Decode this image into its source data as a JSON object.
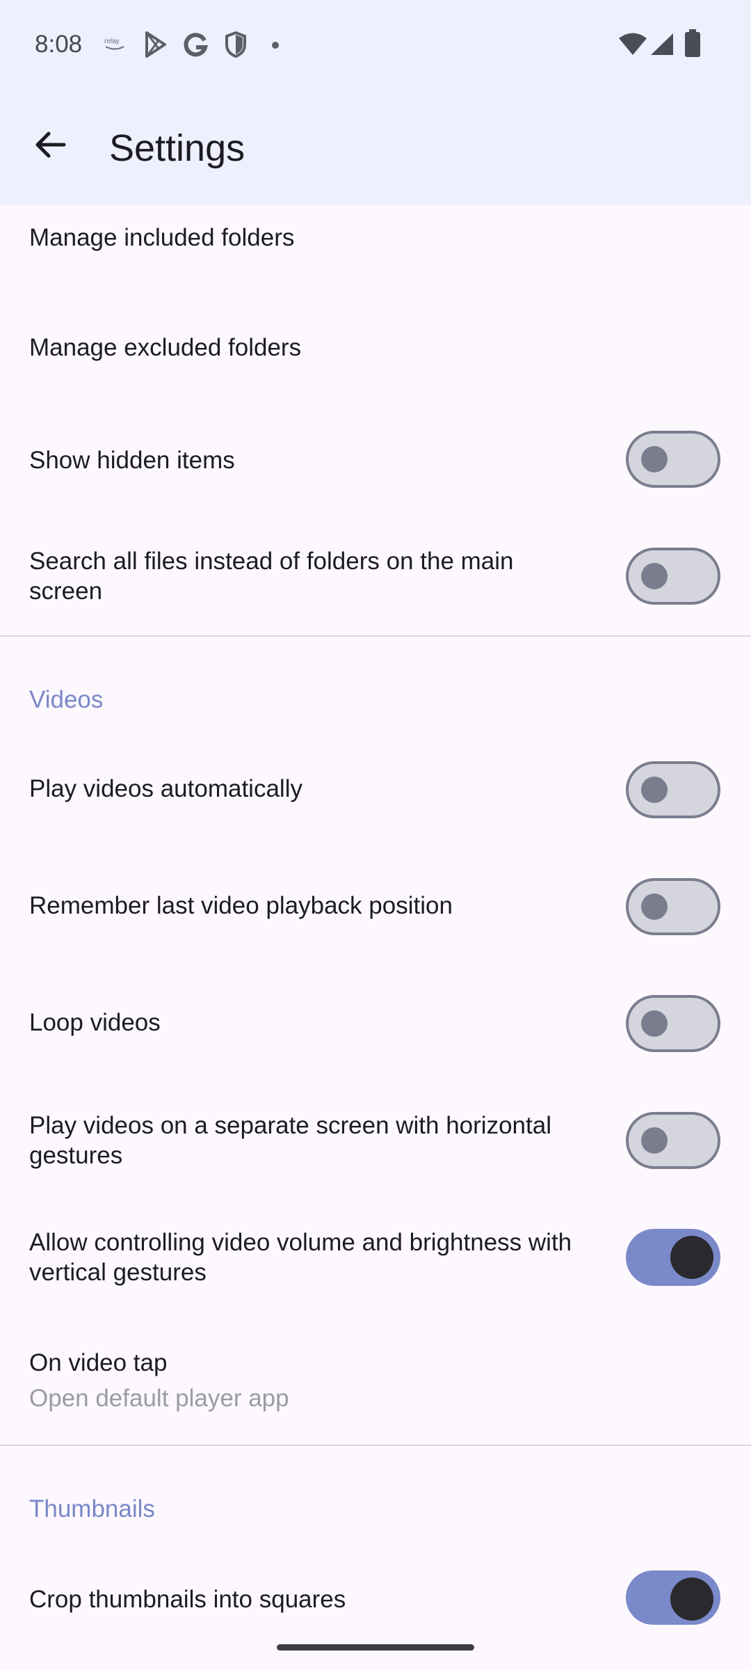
{
  "status_bar": {
    "time": "8:08",
    "left_icons": [
      "relay-icon",
      "play-store-icon",
      "google-icon",
      "shield-icon",
      "dot-icon"
    ],
    "right_icons": [
      "wifi-icon",
      "signal-icon",
      "battery-icon"
    ]
  },
  "app_bar": {
    "title": "Settings",
    "back_icon": "arrow-back-icon"
  },
  "colors": {
    "app_bar_bg": "#eef0fd",
    "page_bg": "#fcf8fd",
    "section_header": "#7a87c8",
    "switch_on": "#7a89c9",
    "switch_off": "#d5d5de"
  },
  "items": {
    "manage_included": "Manage included folders",
    "manage_excluded": "Manage excluded folders",
    "show_hidden": {
      "label": "Show hidden items",
      "checked": false
    },
    "search_all_files": {
      "label": "Search all files instead of folders on the main screen",
      "checked": false
    }
  },
  "videos": {
    "header": "Videos",
    "play_auto": {
      "label": "Play videos automatically",
      "checked": false
    },
    "remember_position": {
      "label": "Remember last video playback position",
      "checked": false
    },
    "loop_videos": {
      "label": "Loop videos",
      "checked": false
    },
    "separate_screen": {
      "label": "Play videos on a separate screen with horizontal gestures",
      "checked": false
    },
    "vertical_gestures": {
      "label": "Allow controlling video volume and brightness with vertical gestures",
      "checked": true
    },
    "on_video_tap": {
      "label": "On video tap",
      "value": "Open default player app"
    }
  },
  "thumbnails": {
    "header": "Thumbnails",
    "crop_squares": {
      "label": "Crop thumbnails into squares",
      "checked": true
    }
  }
}
